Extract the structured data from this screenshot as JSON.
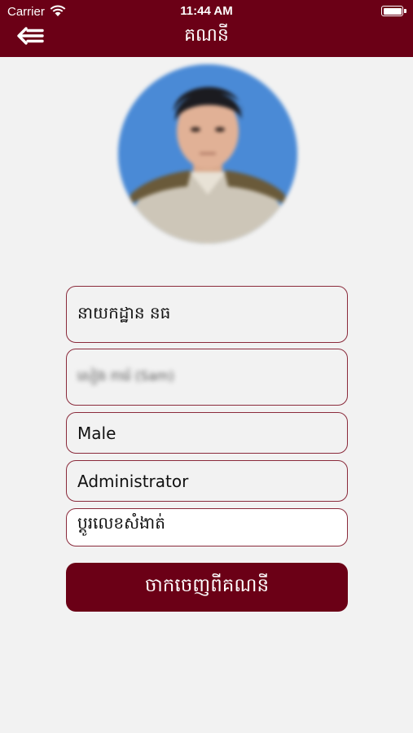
{
  "status_bar": {
    "carrier": "Carrier",
    "time": "11:44 AM"
  },
  "header": {
    "title": "គណនី",
    "back_icon": "back-arrow-icon",
    "background": "#6b0016"
  },
  "profile": {
    "photo": "profile-photo"
  },
  "fields": {
    "name": "នាយកដ្ឋាន នធ",
    "username": "សៀង ការ៉េ (Sam)",
    "gender": "Male",
    "role": "Administrator",
    "change_password": "ប្តូរលេខសំងាត់"
  },
  "actions": {
    "logout": "ចាកចេញពីគណនី"
  }
}
